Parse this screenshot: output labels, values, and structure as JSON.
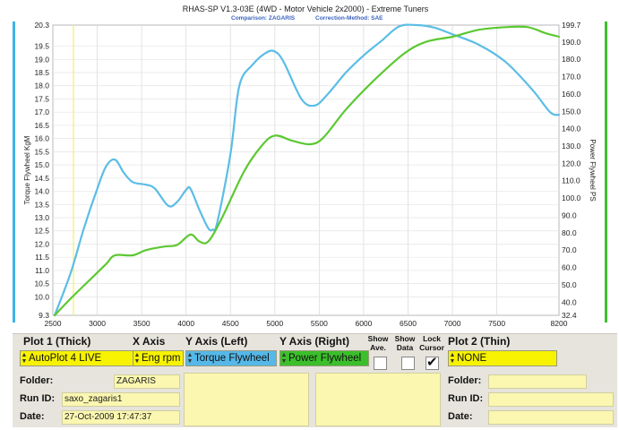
{
  "chart_data": {
    "type": "line",
    "title": "RHAS-SP V1.3-03E  (4WD - Motor Vehicle 2x2000) - Extreme Tuners",
    "subtitle": {
      "comparison": "Comparison: ZAGARIS",
      "correction": "Correction-Method: SAE"
    },
    "xlabel": "",
    "ylabel_left": "Torque Flywheel KgM",
    "ylabel_right": "Power Flywheel PS",
    "xlim": [
      2500,
      8200
    ],
    "ylim_left": [
      9.3,
      20.3
    ],
    "ylim_right": [
      32.4,
      199.7
    ],
    "x_ticks": [
      "2500",
      "3000",
      "3500",
      "4000",
      "4500",
      "5000",
      "5500",
      "6000",
      "6500",
      "7000",
      "7500",
      "8200"
    ],
    "y_left_ticks": [
      "9.3",
      "10.0",
      "10.5",
      "11.0",
      "11.5",
      "12.0",
      "12.5",
      "13.0",
      "13.5",
      "14.0",
      "14.5",
      "15.0",
      "15.5",
      "16.0",
      "16.5",
      "17.0",
      "17.5",
      "18.0",
      "18.5",
      "19.0",
      "19.5",
      "20.3"
    ],
    "y_right_ticks": [
      "32.4",
      "40.0",
      "50.0",
      "60.0",
      "70.0",
      "80.0",
      "90.0",
      "100.0",
      "110.0",
      "120.0",
      "130.0",
      "140.0",
      "150.0",
      "160.0",
      "170.0",
      "180.0",
      "190.0",
      "199.7"
    ],
    "grid": true,
    "series": [
      {
        "name": "Torque Flywheel",
        "axis": "left",
        "color": "#5bbde6",
        "points": [
          [
            2520,
            9.3
          ],
          [
            2700,
            10.9
          ],
          [
            2850,
            12.6
          ],
          [
            3000,
            14.1
          ],
          [
            3100,
            14.95
          ],
          [
            3200,
            15.2
          ],
          [
            3300,
            14.7
          ],
          [
            3400,
            14.35
          ],
          [
            3550,
            14.25
          ],
          [
            3650,
            14.1
          ],
          [
            3800,
            13.45
          ],
          [
            3900,
            13.6
          ],
          [
            4000,
            14.05
          ],
          [
            4050,
            14.1
          ],
          [
            4150,
            13.3
          ],
          [
            4250,
            12.6
          ],
          [
            4300,
            12.55
          ],
          [
            4350,
            12.8
          ],
          [
            4500,
            15.4
          ],
          [
            4600,
            18.0
          ],
          [
            4750,
            18.8
          ],
          [
            4900,
            19.25
          ],
          [
            5000,
            19.3
          ],
          [
            5100,
            18.9
          ],
          [
            5300,
            17.5
          ],
          [
            5450,
            17.25
          ],
          [
            5600,
            17.7
          ],
          [
            5800,
            18.5
          ],
          [
            6000,
            19.15
          ],
          [
            6200,
            19.7
          ],
          [
            6400,
            20.25
          ],
          [
            6600,
            20.3
          ],
          [
            6800,
            20.2
          ],
          [
            7000,
            19.95
          ],
          [
            7300,
            19.55
          ],
          [
            7600,
            18.9
          ],
          [
            7900,
            17.85
          ],
          [
            8100,
            17.0
          ],
          [
            8200,
            16.9
          ]
        ]
      },
      {
        "name": "Power Flywheel",
        "axis": "right",
        "color": "#5cc832",
        "points": [
          [
            2520,
            32.4
          ],
          [
            2700,
            42
          ],
          [
            2900,
            52
          ],
          [
            3100,
            62
          ],
          [
            3200,
            67
          ],
          [
            3400,
            67
          ],
          [
            3550,
            70
          ],
          [
            3750,
            72
          ],
          [
            3900,
            73
          ],
          [
            4050,
            79
          ],
          [
            4150,
            75
          ],
          [
            4250,
            75
          ],
          [
            4400,
            88
          ],
          [
            4650,
            115
          ],
          [
            4850,
            130
          ],
          [
            5000,
            136
          ],
          [
            5200,
            133
          ],
          [
            5400,
            131
          ],
          [
            5550,
            135
          ],
          [
            5800,
            151
          ],
          [
            6100,
            167
          ],
          [
            6450,
            183
          ],
          [
            6700,
            190
          ],
          [
            7000,
            193
          ],
          [
            7300,
            197
          ],
          [
            7600,
            198.5
          ],
          [
            7850,
            198.5
          ],
          [
            8050,
            195
          ],
          [
            8200,
            193
          ]
        ]
      }
    ]
  },
  "panel": {
    "plot1_header": "Plot 1 (Thick)",
    "x_axis_header": "X Axis",
    "y_left_header": "Y Axis (Left)",
    "y_right_header": "Y Axis (Right)",
    "show_ave_header": "Show Ave.",
    "show_data_header": "Show Data",
    "lock_cursor_header": "Lock Cursor",
    "plot2_header": "Plot 2 (Thin)",
    "plot1_value": "AutoPlot 4 LIVE",
    "x_axis_value": "Eng rpm",
    "y_left_value": "Torque Flywheel",
    "y_right_value": "Power Flywheel",
    "plot2_value": "NONE",
    "show_ave_checked": false,
    "show_data_checked": false,
    "lock_cursor_checked": true,
    "plot1_info": {
      "folder_label": "Folder:",
      "folder_value": "ZAGARIS",
      "run_label": "Run ID:",
      "run_value": "saxo_zagaris1",
      "date_label": "Date:",
      "date_value": "27-Oct-2009  17:47:37"
    },
    "plot2_info": {
      "folder_label": "Folder:",
      "folder_value": "",
      "run_label": "Run ID:",
      "run_value": "",
      "date_label": "Date:",
      "date_value": ""
    }
  }
}
